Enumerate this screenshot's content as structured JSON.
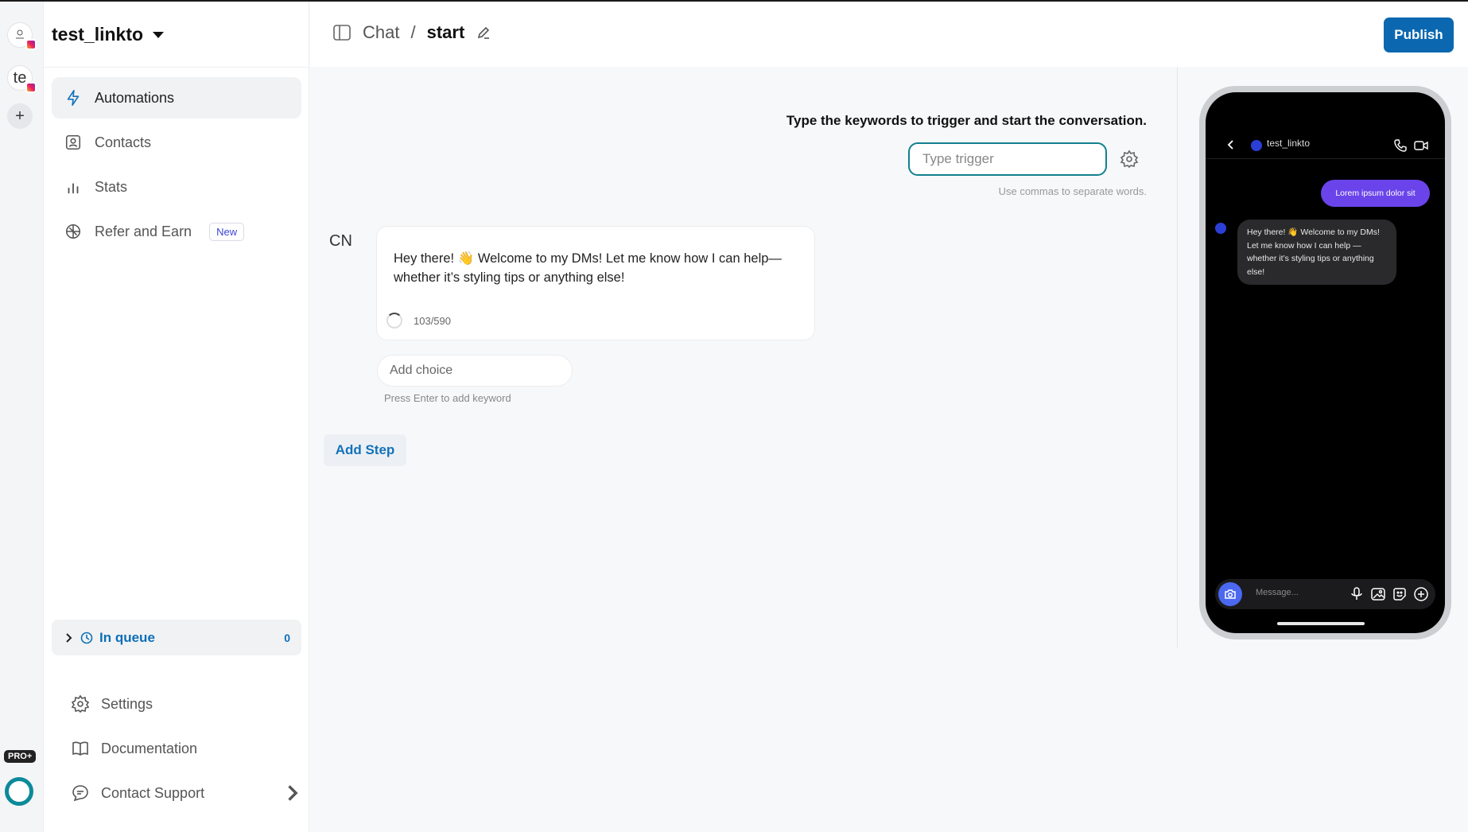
{
  "workspace": {
    "name": "test_linkto"
  },
  "accounts": [
    {
      "initials": ""
    },
    {
      "initials": "te"
    }
  ],
  "sidebar": {
    "nav": [
      {
        "label": "Automations",
        "icon": "lightning-icon",
        "active": true
      },
      {
        "label": "Contacts",
        "icon": "contact-card-icon"
      },
      {
        "label": "Stats",
        "icon": "bar-chart-icon"
      },
      {
        "label": "Refer and Earn",
        "icon": "gift-icon",
        "badge": "New"
      }
    ],
    "queue": {
      "label": "In queue",
      "count": "0"
    },
    "bottom": [
      {
        "label": "Settings",
        "icon": "gear-icon"
      },
      {
        "label": "Documentation",
        "icon": "book-icon"
      },
      {
        "label": "Contact Support",
        "icon": "support-chat-icon"
      }
    ],
    "pro_badge": "PRO+"
  },
  "header": {
    "breadcrumb": [
      "Chat",
      "start"
    ],
    "separator": "/",
    "publish_label": "Publish"
  },
  "trigger": {
    "title": "Type the keywords to trigger and start the conversation.",
    "placeholder": "Type trigger",
    "hint": "Use commas to separate words."
  },
  "step": {
    "sender": "CN",
    "message": "Hey there! 👋 Welcome to my DMs! Let me know how I can help—whether it’s styling tips or anything else!",
    "char_count": "103/590",
    "choice_placeholder": "Add choice",
    "choice_hint": "Press Enter to add keyword",
    "add_step_label": "Add Step"
  },
  "preview": {
    "username": "test_linkto",
    "outgoing": "Lorem ipsum dolor sit",
    "incoming": "Hey there! 👋 Welcome to my DMs! Let me know how I can help —whether it’s styling tips or anything else!",
    "message_placeholder": "Message..."
  },
  "colors": {
    "primary": "#0b68b0",
    "trigger_border": "#13808e",
    "outgoing_bubble": "#6a44ea",
    "avatar": "#2b3fd6"
  }
}
